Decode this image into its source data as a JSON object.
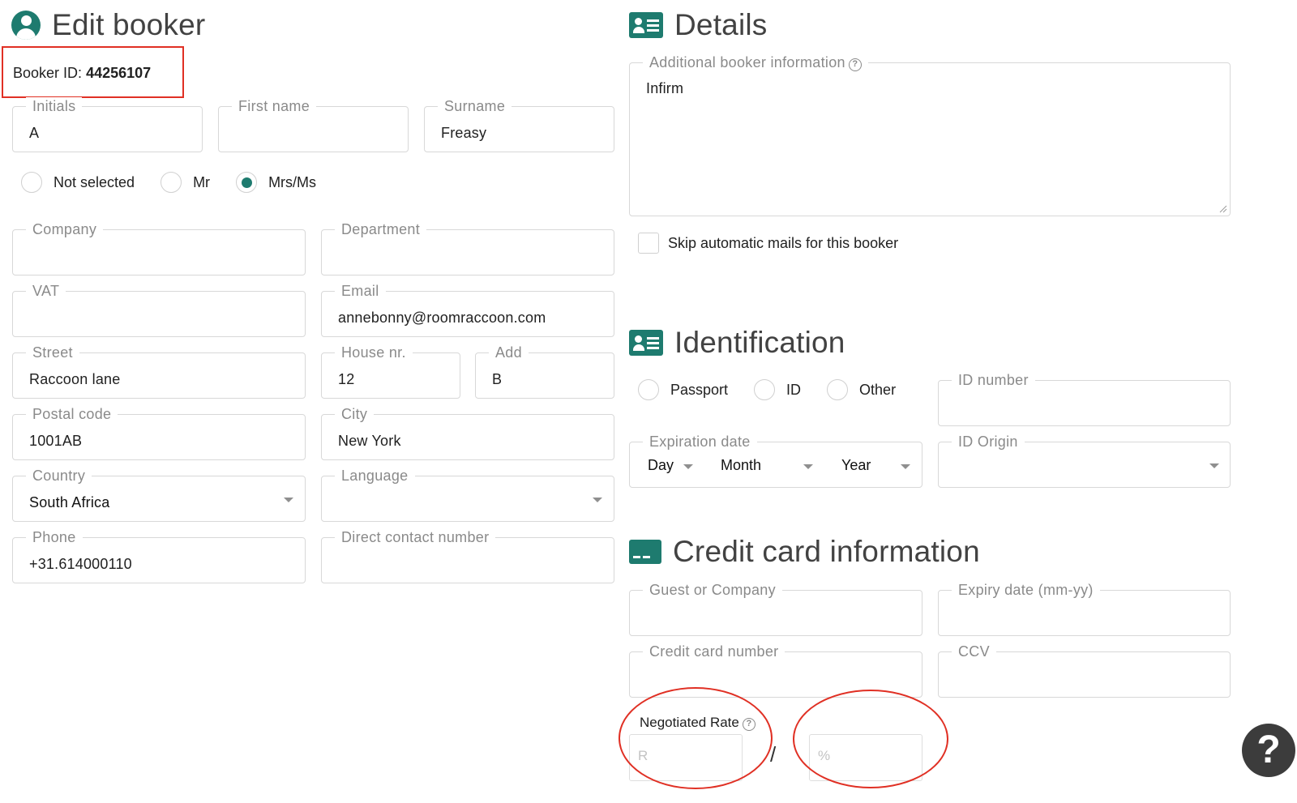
{
  "edit_booker": {
    "title": "Edit booker",
    "booker_id_label": "Booker ID:",
    "booker_id_value": "44256107",
    "initials": {
      "label": "Initials",
      "value": "A"
    },
    "first_name": {
      "label": "First name",
      "value": ""
    },
    "surname": {
      "label": "Surname",
      "value": "Freasy"
    },
    "salutation": {
      "options": [
        "Not selected",
        "Mr",
        "Mrs/Ms"
      ],
      "selected": "Mrs/Ms"
    },
    "company": {
      "label": "Company",
      "value": ""
    },
    "department": {
      "label": "Department",
      "value": ""
    },
    "vat": {
      "label": "VAT",
      "value": ""
    },
    "email": {
      "label": "Email",
      "value": "annebonny@roomraccoon.com"
    },
    "street": {
      "label": "Street",
      "value": "Raccoon lane"
    },
    "house_nr": {
      "label": "House nr.",
      "value": "12"
    },
    "add": {
      "label": "Add",
      "value": "B"
    },
    "postal_code": {
      "label": "Postal code",
      "value": "1001AB"
    },
    "city": {
      "label": "City",
      "value": "New York"
    },
    "country": {
      "label": "Country",
      "value": "South Africa"
    },
    "language": {
      "label": "Language",
      "value": ""
    },
    "phone": {
      "label": "Phone",
      "value": "+31.614000110"
    },
    "direct_contact": {
      "label": "Direct contact number",
      "value": ""
    }
  },
  "details": {
    "title": "Details",
    "additional_info": {
      "label": "Additional booker information",
      "value": "Infirm"
    },
    "skip_mails_label": "Skip automatic mails for this booker"
  },
  "identification": {
    "title": "Identification",
    "id_type": {
      "options": [
        "Passport",
        "ID",
        "Other"
      ],
      "selected": ""
    },
    "id_number": {
      "label": "ID number",
      "value": ""
    },
    "expiration": {
      "label": "Expiration date",
      "day": "Day",
      "month": "Month",
      "year": "Year"
    },
    "id_origin": {
      "label": "ID Origin",
      "value": ""
    }
  },
  "credit_card": {
    "title": "Credit card information",
    "guest_or_company": {
      "label": "Guest or Company",
      "value": ""
    },
    "expiry_date": {
      "label": "Expiry date (mm-yy)",
      "value": ""
    },
    "card_number": {
      "label": "Credit card number",
      "value": ""
    },
    "ccv": {
      "label": "CCV",
      "value": ""
    },
    "negotiated_rate": {
      "label": "Negotiated Rate",
      "amount_placeholder": "R",
      "percent_placeholder": "%",
      "separator": "/"
    }
  },
  "help_fab": {
    "symbol": "?"
  },
  "colors": {
    "accent": "#1e7b6f",
    "highlight": "#e03024"
  }
}
